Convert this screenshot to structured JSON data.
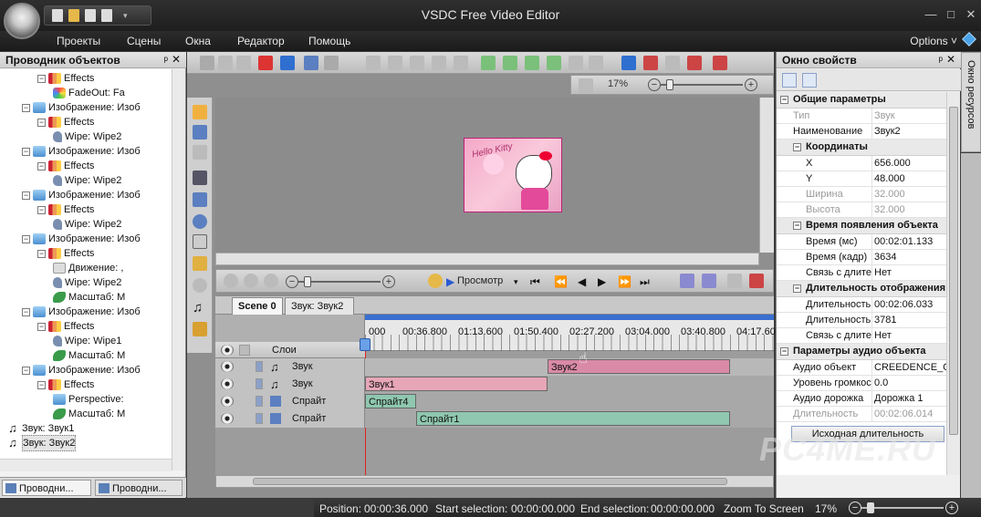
{
  "window": {
    "title": "VSDC Free Video Editor",
    "controls": [
      "—",
      "□",
      "✕"
    ]
  },
  "menu": {
    "items": [
      "Проекты",
      "Сцены",
      "Окна",
      "Редактор",
      "Помощь"
    ],
    "options_label": "Options ˅"
  },
  "left_panel": {
    "title": "Проводник объектов",
    "pin": "ᵖ",
    "close": "✕",
    "tree": [
      {
        "indent": 3,
        "expander": "−",
        "icon": "effects-icon",
        "label": "Effects"
      },
      {
        "indent": 4,
        "expander": "",
        "icon": "fadeout-icon",
        "label": "FadeOut: Fa"
      },
      {
        "indent": 2,
        "expander": "−",
        "icon": "image-icon",
        "label": "Изображение: Изоб"
      },
      {
        "indent": 3,
        "expander": "−",
        "icon": "effects-icon",
        "label": "Effects"
      },
      {
        "indent": 4,
        "expander": "",
        "icon": "wipe-icon",
        "label": "Wipe: Wipe2"
      },
      {
        "indent": 2,
        "expander": "−",
        "icon": "image-icon",
        "label": "Изображение: Изоб"
      },
      {
        "indent": 3,
        "expander": "−",
        "icon": "effects-icon",
        "label": "Effects"
      },
      {
        "indent": 4,
        "expander": "",
        "icon": "wipe-icon",
        "label": "Wipe: Wipe2"
      },
      {
        "indent": 2,
        "expander": "−",
        "icon": "image-icon",
        "label": "Изображение: Изоб"
      },
      {
        "indent": 3,
        "expander": "−",
        "icon": "effects-icon",
        "label": "Effects"
      },
      {
        "indent": 4,
        "expander": "",
        "icon": "wipe-icon",
        "label": "Wipe: Wipe2"
      },
      {
        "indent": 2,
        "expander": "−",
        "icon": "image-icon",
        "label": "Изображение: Изоб"
      },
      {
        "indent": 3,
        "expander": "−",
        "icon": "effects-icon",
        "label": "Effects"
      },
      {
        "indent": 4,
        "expander": "",
        "icon": "move-icon",
        "label": "Движение: ,"
      },
      {
        "indent": 4,
        "expander": "",
        "icon": "wipe-icon",
        "label": "Wipe: Wipe2"
      },
      {
        "indent": 4,
        "expander": "",
        "icon": "scale-icon",
        "label": "Масштаб: М"
      },
      {
        "indent": 2,
        "expander": "−",
        "icon": "image-icon",
        "label": "Изображение: Изоб"
      },
      {
        "indent": 3,
        "expander": "−",
        "icon": "effects-icon",
        "label": "Effects"
      },
      {
        "indent": 4,
        "expander": "",
        "icon": "wipe-icon",
        "label": "Wipe: Wipe1"
      },
      {
        "indent": 4,
        "expander": "",
        "icon": "scale-icon",
        "label": "Масштаб: М"
      },
      {
        "indent": 2,
        "expander": "−",
        "icon": "image-icon",
        "label": "Изображение: Изоб"
      },
      {
        "indent": 3,
        "expander": "−",
        "icon": "effects-icon",
        "label": "Effects"
      },
      {
        "indent": 4,
        "expander": "",
        "icon": "perspective-icon",
        "label": "Perspective:"
      },
      {
        "indent": 4,
        "expander": "",
        "icon": "scale-icon",
        "label": "Масштаб: М"
      },
      {
        "indent": 1,
        "expander": "",
        "icon": "music-note-icon",
        "label": "Звук: Звук1"
      },
      {
        "indent": 1,
        "expander": "",
        "icon": "music-note-icon",
        "label": "Звук: Звук2"
      }
    ],
    "tabs": [
      "Проводни...",
      "Проводни..."
    ]
  },
  "preview": {
    "zoom": "17%",
    "image_text": "Hello Kitty"
  },
  "transport": {
    "play_label": "Просмотр",
    "buttons": [
      "⏮",
      "⏪",
      "◀",
      "▶",
      "⏩",
      "⏭"
    ]
  },
  "scenes": {
    "tabs": [
      "Scene 0",
      "Звук: Звук2"
    ]
  },
  "timeline": {
    "layers_label": "Слои",
    "ruler": [
      "000",
      "00:36.800",
      "01:13.600",
      "01:50.400",
      "02:27.200",
      "03:04.000",
      "03:40.800",
      "04:17.600"
    ],
    "tracks": [
      {
        "type": "audio",
        "label": "Звук",
        "clips": [
          {
            "label": "Звук2",
            "start": 0.5,
            "end": 1.0,
            "style": "audio2"
          }
        ]
      },
      {
        "type": "audio",
        "label": "Звук",
        "clips": [
          {
            "label": "Звук1",
            "start": 0.0,
            "end": 0.5,
            "style": "audio"
          }
        ]
      },
      {
        "type": "sprite",
        "label": "Спрайт",
        "clips": [
          {
            "label": "Спрайт4",
            "start": 0.0,
            "end": 0.14,
            "style": "sprite"
          }
        ]
      },
      {
        "type": "sprite",
        "label": "Спрайт",
        "clips": [
          {
            "label": "Спрайт1",
            "start": 0.14,
            "end": 1.0,
            "style": "sprite"
          }
        ]
      }
    ]
  },
  "properties": {
    "title": "Окно свойств",
    "groups": [
      {
        "kind": "group",
        "label": "Общие параметры"
      },
      {
        "kind": "row",
        "key": "Тип",
        "value": "Звук",
        "dim": true
      },
      {
        "kind": "row",
        "key": "Наименование",
        "value": "Звук2"
      },
      {
        "kind": "subgroup",
        "label": "Координаты"
      },
      {
        "kind": "subrow",
        "key": "X",
        "value": "656.000"
      },
      {
        "kind": "subrow",
        "key": "Y",
        "value": "48.000"
      },
      {
        "kind": "subrow",
        "key": "Ширина",
        "value": "32.000",
        "dim": true
      },
      {
        "kind": "subrow",
        "key": "Высота",
        "value": "32.000",
        "dim": true
      },
      {
        "kind": "subgroup",
        "label": "Время появления объекта"
      },
      {
        "kind": "subrow",
        "key": "Время (мс)",
        "value": "00:02:01.133"
      },
      {
        "kind": "subrow",
        "key": "Время (кадр)",
        "value": "3634"
      },
      {
        "kind": "subrow",
        "key": "Связь с длите",
        "value": "Нет"
      },
      {
        "kind": "subgroup",
        "label": "Длительность отображения"
      },
      {
        "kind": "subrow",
        "key": "Длительность",
        "value": "00:02:06.033"
      },
      {
        "kind": "subrow",
        "key": "Длительность",
        "value": "3781"
      },
      {
        "kind": "subrow",
        "key": "Связь с длите",
        "value": "Нет"
      },
      {
        "kind": "group",
        "label": "Параметры аудио объекта"
      },
      {
        "kind": "row",
        "key": "Аудио объект",
        "value": "CREEDENCE_CL"
      },
      {
        "kind": "row",
        "key": "Уровень громкос",
        "value": "0.0"
      },
      {
        "kind": "row",
        "key": "Аудио дорожка",
        "value": "Дорожка 1"
      },
      {
        "kind": "row",
        "key": "Длительность",
        "value": "00:02:06.014",
        "dim": true
      }
    ],
    "source_button": "Исходная длительность"
  },
  "resource_tab": "Окно ресурсов",
  "status": {
    "position_label": "Position:",
    "position_value": "00:00:36.000",
    "start_label": "Start selection:",
    "start_value": "00:00:00.000",
    "end_label": "End selection:",
    "end_value": "00:00:00.000",
    "zoom_label": "Zoom To Screen",
    "zoom_value": "17%"
  },
  "watermark": "PC4ME.RU"
}
